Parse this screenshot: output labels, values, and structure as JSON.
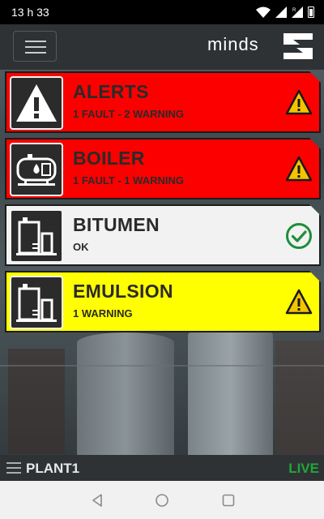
{
  "status_bar": {
    "time": "13 h 33",
    "icons": [
      "wifi-icon",
      "signal-icon",
      "signal-r-icon",
      "battery-icon"
    ]
  },
  "header": {
    "menu_icon": "hamburger-icon",
    "logo_text": "minds"
  },
  "cards": [
    {
      "title": "ALERTS",
      "subtitle": "1 FAULT - 2 WARNING",
      "icon": "alert-triangle-icon",
      "status_icon": "warning-icon",
      "color": "#fc0000"
    },
    {
      "title": "BOILER",
      "subtitle": "1 FAULT - 1 WARNING",
      "icon": "boiler-icon",
      "status_icon": "warning-icon",
      "color": "#fc0000"
    },
    {
      "title": "BITUMEN",
      "subtitle": "OK",
      "icon": "tank-icon",
      "status_icon": "check-circle-icon",
      "color": "#f2f2f2"
    },
    {
      "title": "EMULSION",
      "subtitle": "1 WARNING",
      "icon": "tank-icon",
      "status_icon": "warning-icon",
      "color": "#ffff00"
    }
  ],
  "footer": {
    "plant": "PLANT1",
    "live": "LIVE",
    "live_color": "#22a53b"
  },
  "android_nav": {
    "back": "back-icon",
    "home": "home-icon",
    "recents": "recents-icon"
  }
}
